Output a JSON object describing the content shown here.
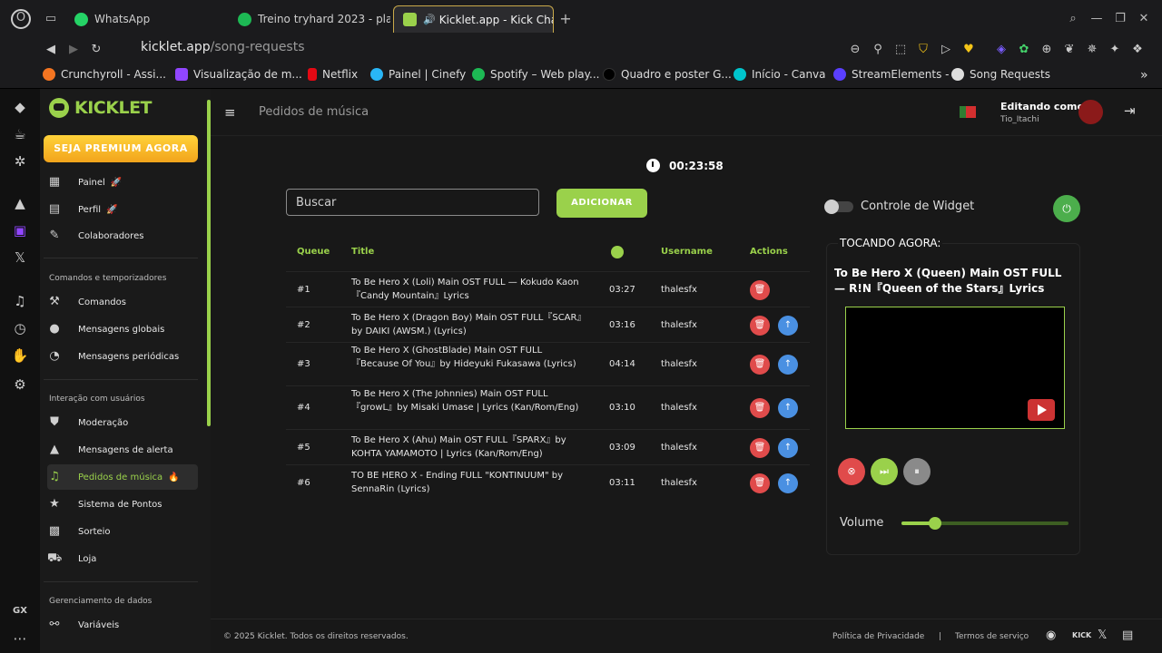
{
  "browser": {
    "tabs": [
      {
        "label": "WhatsApp",
        "color": "#25d366"
      },
      {
        "label": "Treino tryhard 2023 - pla",
        "color": "#1db954"
      },
      {
        "label": "Kicklet.app - Kick Cha",
        "color": "#9ad14b",
        "active": true
      }
    ],
    "new_tab": "+",
    "url_host": "kicklet.app",
    "url_path": "/song-requests",
    "bookmarks": [
      {
        "label": "Crunchyroll - Assi...",
        "color": "#f47521"
      },
      {
        "label": "Visualização de m...",
        "color": "#9146ff"
      },
      {
        "label": "Netflix",
        "color": "#e50914"
      },
      {
        "label": "Painel | Cinefy",
        "color": "#29b6f6"
      },
      {
        "label": "Spotify – Web play...",
        "color": "#1db954"
      },
      {
        "label": "Quadro e poster G...",
        "color": "#111111"
      },
      {
        "label": "Início - Canva",
        "color": "#00c4cc"
      },
      {
        "label": "StreamElements -",
        "color": "#5a3fff"
      },
      {
        "label": "Song Requests",
        "color": "#dddddd"
      }
    ]
  },
  "sidebar": {
    "brand": "KICKLET",
    "premium": "SEJA PREMIUM AGORA",
    "items_top": [
      {
        "label": "Painel",
        "emoji": "🚀"
      },
      {
        "label": "Perfil",
        "emoji": "🚀"
      },
      {
        "label": "Colaboradores",
        "emoji": ""
      }
    ],
    "section1": "Comandos e temporizadores",
    "items_cmd": [
      "Comandos",
      "Mensagens globais",
      "Mensagens periódicas"
    ],
    "section2": "Interação com usuários",
    "items_user": [
      {
        "label": "Moderação",
        "emoji": ""
      },
      {
        "label": "Mensagens de alerta",
        "emoji": ""
      },
      {
        "label": "Pedidos de música",
        "emoji": "🔥",
        "active": true
      },
      {
        "label": "Sistema de Pontos",
        "emoji": ""
      },
      {
        "label": "Sorteio",
        "emoji": ""
      },
      {
        "label": "Loja",
        "emoji": ""
      }
    ],
    "section3": "Gerenciamento de dados",
    "items_data": [
      "Variáveis"
    ],
    "gx_label": "GX"
  },
  "header": {
    "page_title": "Pedidos de música",
    "editing_as": "Editando como",
    "username": "Tio_Itachi"
  },
  "timer": "00:23:58",
  "search": {
    "placeholder": "Buscar"
  },
  "add_button": "ADICIONAR",
  "queue": {
    "columns": {
      "queue": "Queue",
      "title": "Title",
      "username": "Username",
      "actions": "Actions"
    },
    "rows": [
      {
        "pos": "#1",
        "title": "To Be Hero X (Loli) Main OST FULL — Kokudo Kaon『Candy Mountain』Lyrics",
        "duration": "03:27",
        "user": "thalesfx",
        "can_move_up": false
      },
      {
        "pos": "#2",
        "title": "To Be Hero X (Dragon Boy) Main OST FULL『SCAR』by DAIKI (AWSM.) (Lyrics)",
        "duration": "03:16",
        "user": "thalesfx",
        "can_move_up": true
      },
      {
        "pos": "#3",
        "title": "To Be Hero X (GhostBlade) Main OST FULL『Because Of You』by Hideyuki Fukasawa (Lyrics)",
        "duration": "04:14",
        "user": "thalesfx",
        "can_move_up": true
      },
      {
        "pos": "#4",
        "title": "To Be Hero X (The Johnnies) Main OST FULL『growL』by Misaki Umase | Lyrics (Kan/Rom/Eng)",
        "duration": "03:10",
        "user": "thalesfx",
        "can_move_up": true
      },
      {
        "pos": "#5",
        "title": "To Be Hero X (Ahu) Main OST FULL『SPARX』by KOHTA YAMAMOTO | Lyrics (Kan/Rom/Eng)",
        "duration": "03:09",
        "user": "thalesfx",
        "can_move_up": true
      },
      {
        "pos": "#6",
        "title": "TO BE HERO X - Ending FULL \"KONTINUUM\" by SennaRin (Lyrics)",
        "duration": "03:11",
        "user": "thalesfx",
        "can_move_up": true
      }
    ]
  },
  "widget_control": "Controle de Widget",
  "now_playing": {
    "label": "TOCANDO AGORA:",
    "title": "To Be Hero X (Queen) Main OST FULL — R!N『Queen of the Stars』Lyrics"
  },
  "volume": {
    "label": "Volume",
    "level": 0.2
  },
  "footer": {
    "copyright": "© 2025 Kicklet. Todos os direitos reservados.",
    "privacy": "Política de Privacidade",
    "sep": "|",
    "terms": "Termos de serviço",
    "kick": "KICK"
  },
  "colors": {
    "accent": "#9ad14b",
    "danger": "#e04b4b",
    "info": "#4a90e2"
  }
}
